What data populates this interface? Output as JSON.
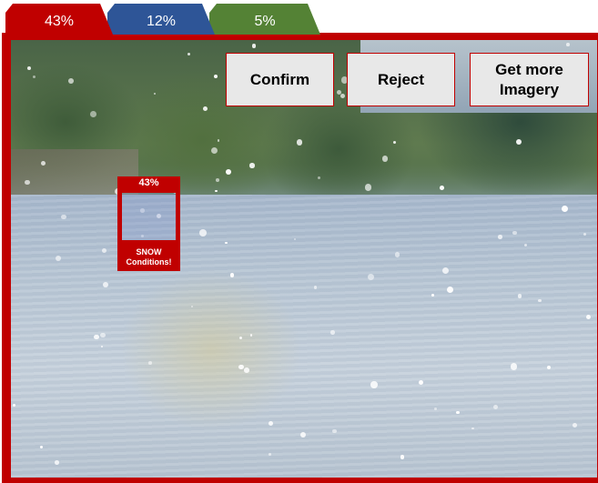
{
  "tabs": [
    {
      "label": "43%",
      "color": "#c00000"
    },
    {
      "label": "12%",
      "color": "#2e5597"
    },
    {
      "label": "5%",
      "color": "#548235"
    }
  ],
  "buttons": {
    "confirm": "Confirm",
    "reject": "Reject",
    "more_line1": "Get more",
    "more_line2": "Imagery"
  },
  "detection": {
    "confidence": "43%",
    "caption_line1": "SNOW",
    "caption_line2": "Conditions!"
  },
  "colors": {
    "accent": "#c00000",
    "button_bg": "#e8e8e8"
  },
  "scene": {
    "image": "river-snowfall-photo"
  }
}
